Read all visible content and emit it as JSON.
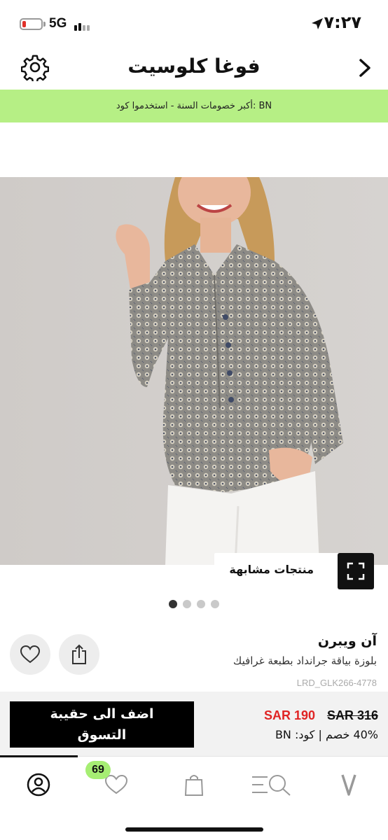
{
  "status_bar": {
    "time": "٧:٢٧",
    "network": "5G"
  },
  "header": {
    "brand": "فوغا كلوسيت",
    "icons": {
      "settings": "gear-icon",
      "back": "chevron-right-icon"
    }
  },
  "promo": {
    "text": "أكبر خصومات السنة - استخدموا كود: BN",
    "color": "#b6ef85"
  },
  "gallery": {
    "similar_products_label": "منتجات مشابهة",
    "pages": 4,
    "active_page": 1
  },
  "product": {
    "brand": "آن ويبرن",
    "title": "بلوزة بياقة جرانداد بطبعة غرافيك",
    "sku": "LRD_GLK266-4778"
  },
  "purchase": {
    "add_to_bag_label": "اضف الى حقيبة التسوق",
    "old_price": "SAR 316",
    "new_price": "SAR 190",
    "discount_line": "40% خصم | كود: BN",
    "sale_color": "#e02424"
  },
  "bottom_nav": {
    "wishlist_badge": "69",
    "items": [
      "profile-icon",
      "heart-icon",
      "shopping-bag-icon",
      "search-menu-icon",
      "brand-logo-icon"
    ]
  }
}
